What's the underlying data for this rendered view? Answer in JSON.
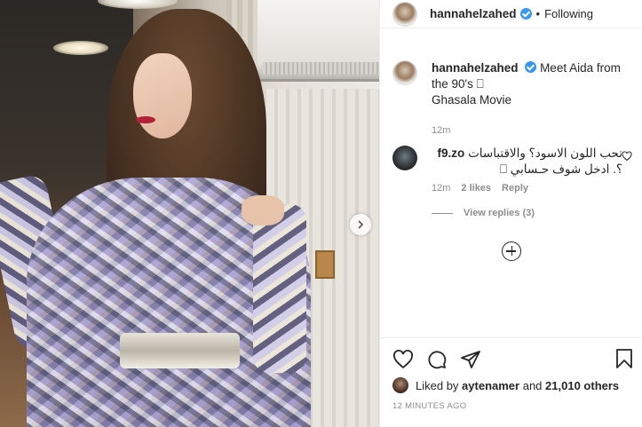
{
  "post": {
    "username": "hannahelzahed",
    "follow_status": "Following",
    "separator": "•"
  },
  "caption": {
    "username": "hannahelzahed",
    "text": "Meet Aida from the 90's ⎕",
    "line2": "Ghasala Movie",
    "age": "12m"
  },
  "comment": {
    "username": "f9.zo",
    "text": "تحب اللون الاسود؟ والاقتباسات",
    "text2": "؟. ادخل شوف حـسابي ⎕",
    "age": "12m",
    "likes": "2 likes",
    "reply": "Reply",
    "view_replies": "View replies (3)"
  },
  "likes": {
    "prefix": "Liked by",
    "user": "aytenamer",
    "mid": "and",
    "count": "21,010 others"
  },
  "timestamp": "12 MINUTES AGO",
  "colors": {
    "verified": "#3897f0",
    "text": "#262626",
    "muted": "#8e8e8e"
  }
}
